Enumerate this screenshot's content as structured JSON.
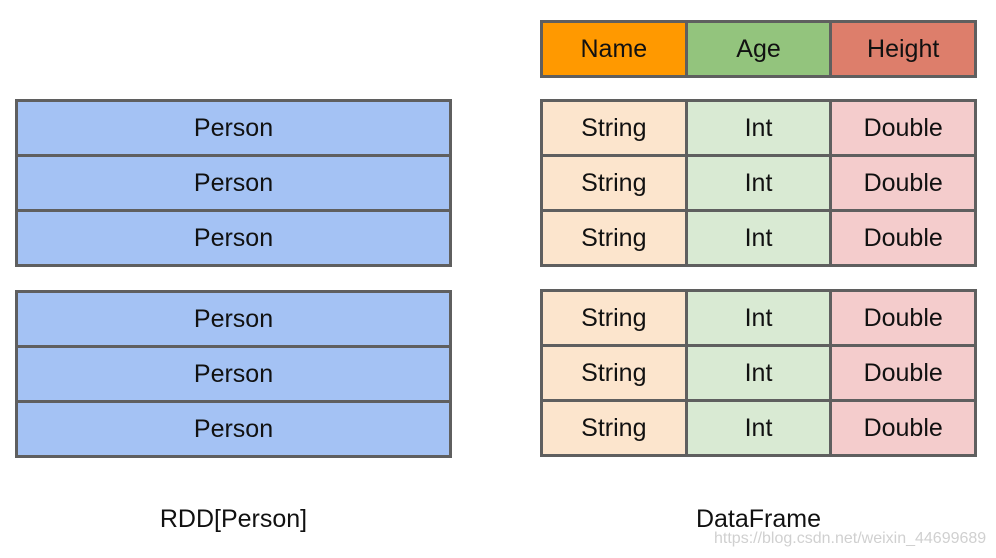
{
  "rdd": {
    "caption": "RDD[Person]",
    "partitions": [
      [
        "Person",
        "Person",
        "Person"
      ],
      [
        "Person",
        "Person",
        "Person"
      ]
    ]
  },
  "dataframe": {
    "caption": "DataFrame",
    "header": [
      "Name",
      "Age",
      "Height"
    ],
    "partitions": [
      [
        [
          "String",
          "Int",
          "Double"
        ],
        [
          "String",
          "Int",
          "Double"
        ],
        [
          "String",
          "Int",
          "Double"
        ]
      ],
      [
        [
          "String",
          "Int",
          "Double"
        ],
        [
          "String",
          "Int",
          "Double"
        ],
        [
          "String",
          "Int",
          "Double"
        ]
      ]
    ]
  },
  "colors": {
    "person": "#a4c2f4",
    "name_header": "#ff9900",
    "age_header": "#93c47d",
    "height_header": "#dd7e6b",
    "string_cell": "#fce5cd",
    "int_cell": "#d9ead3",
    "double_cell": "#f4cccc"
  },
  "watermark": "https://blog.csdn.net/weixin_44699689"
}
